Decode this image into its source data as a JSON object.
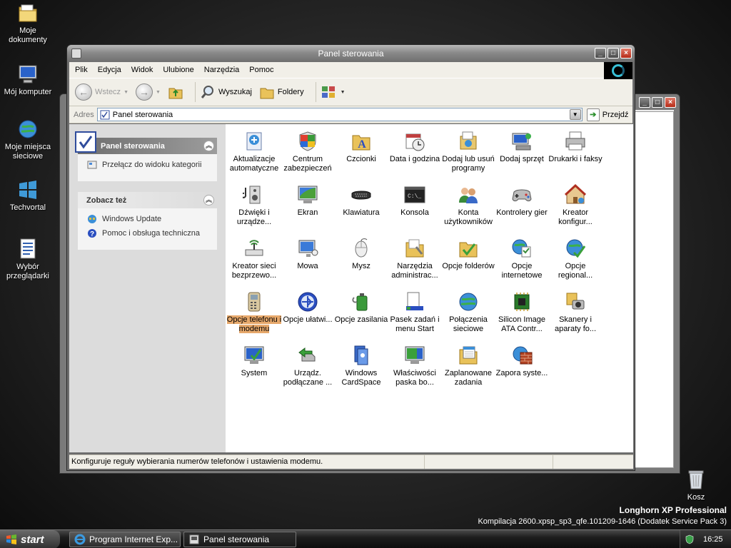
{
  "desktop": {
    "icons": [
      {
        "label": "Moje dokumenty",
        "icon": "folder-icon"
      },
      {
        "label": "Mój komputer",
        "icon": "computer-icon"
      },
      {
        "label": "Moje miejsca sieciowe",
        "icon": "network-icon"
      },
      {
        "label": "Techvortal",
        "icon": "windows-flag-icon"
      },
      {
        "label": "Wybór przeglądarki",
        "icon": "document-icon"
      },
      {
        "label": "Kosz",
        "icon": "recycle-bin-icon"
      }
    ],
    "watermark_line1": "Longhorn XP Professional",
    "watermark_line2": "Kompilacja 2600.xpsp_sp3_qfe.101209-1646 (Dodatek Service Pack 3)"
  },
  "window": {
    "title": "Panel sterowania",
    "menu": [
      "Plik",
      "Edycja",
      "Widok",
      "Ulubione",
      "Narzędzia",
      "Pomoc"
    ],
    "toolbar": {
      "back": "Wstecz",
      "search": "Wyszukaj",
      "folders": "Foldery"
    },
    "address": {
      "label": "Adres",
      "value": "Panel sterowania",
      "go": "Przejdź"
    },
    "left_panel": {
      "section1_title": "Panel sterowania",
      "section1_link": "Przełącz do widoku kategorii",
      "section2_title": "Zobacz też",
      "section2_links": [
        "Windows Update",
        "Pomoc i obsługa techniczna"
      ]
    },
    "items": [
      {
        "label": "Aktualizacje automatyczne",
        "icon": "update-icon"
      },
      {
        "label": "Centrum zabezpieczeń",
        "icon": "shield-icon"
      },
      {
        "label": "Czcionki",
        "icon": "fonts-folder-icon"
      },
      {
        "label": "Data i godzina",
        "icon": "clock-icon"
      },
      {
        "label": "Dodaj lub usuń programy",
        "icon": "add-remove-icon"
      },
      {
        "label": "Dodaj sprzęt",
        "icon": "hardware-icon"
      },
      {
        "label": "Drukarki i faksy",
        "icon": "printer-icon"
      },
      {
        "label": "Dźwięki i urządze...",
        "icon": "speaker-icon"
      },
      {
        "label": "Ekran",
        "icon": "display-icon"
      },
      {
        "label": "Klawiatura",
        "icon": "keyboard-icon"
      },
      {
        "label": "Konsola",
        "icon": "console-icon"
      },
      {
        "label": "Konta użytkowników",
        "icon": "users-icon"
      },
      {
        "label": "Kontrolery gier",
        "icon": "gamepad-icon"
      },
      {
        "label": "Kreator konfigur...",
        "icon": "house-icon"
      },
      {
        "label": "Kreator sieci bezprzewo...",
        "icon": "wireless-icon"
      },
      {
        "label": "Mowa",
        "icon": "speech-icon"
      },
      {
        "label": "Mysz",
        "icon": "mouse-icon"
      },
      {
        "label": "Narzędzia administrac...",
        "icon": "admin-tools-icon"
      },
      {
        "label": "Opcje folderów",
        "icon": "folder-options-icon"
      },
      {
        "label": "Opcje internetowe",
        "icon": "internet-options-icon"
      },
      {
        "label": "Opcje regional...",
        "icon": "globe-check-icon"
      },
      {
        "label": "Opcje telefonu i modemu",
        "icon": "phone-icon"
      },
      {
        "label": "Opcje ułatwi...",
        "icon": "accessibility-icon"
      },
      {
        "label": "Opcje zasilania",
        "icon": "power-icon"
      },
      {
        "label": "Pasek zadań i menu Start",
        "icon": "taskbar-icon"
      },
      {
        "label": "Połączenia sieciowe",
        "icon": "network-globe-icon"
      },
      {
        "label": "Silicon Image ATA Contr...",
        "icon": "chip-icon"
      },
      {
        "label": "Skanery i aparaty fo...",
        "icon": "scanner-icon"
      },
      {
        "label": "System",
        "icon": "system-icon"
      },
      {
        "label": "Urządz. podłączane ...",
        "icon": "plug-icon"
      },
      {
        "label": "Windows CardSpace",
        "icon": "cardspace-icon"
      },
      {
        "label": "Właściwości paska bo...",
        "icon": "sidebar-icon"
      },
      {
        "label": "Zaplanowane zadania",
        "icon": "calendar-icon"
      },
      {
        "label": "Zapora syste...",
        "icon": "firewall-icon"
      }
    ],
    "selected_index": 21,
    "status_text": "Konfiguruje reguły wybierania numerów telefonów i ustawienia modemu."
  },
  "taskbar": {
    "start": "start",
    "tasks": [
      "Program Internet Exp...",
      "Panel sterowania"
    ],
    "clock": "16:25"
  }
}
